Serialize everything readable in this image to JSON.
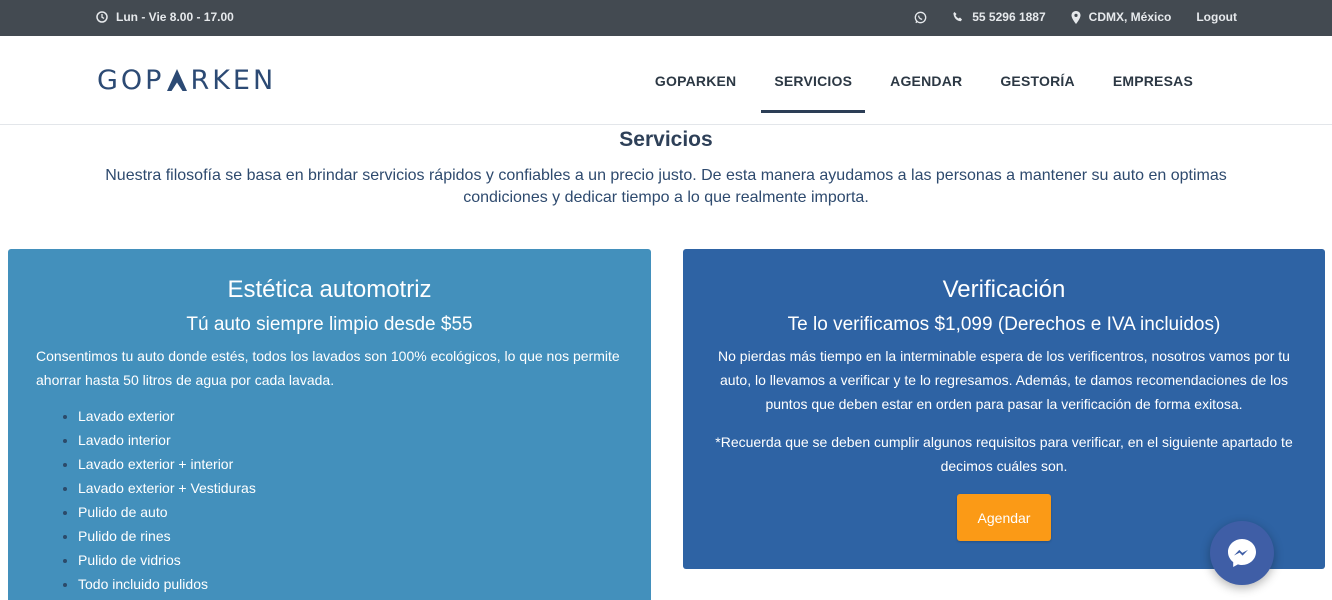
{
  "topbar": {
    "hours": "Lun - Vie 8.00 - 17.00",
    "phone": "55 5296 1887",
    "location": "CDMX, México",
    "logout": "Logout"
  },
  "header": {
    "logo_text_left": "GOP",
    "logo_text_right": "RKEN",
    "nav": [
      {
        "label": "GOPARKEN",
        "active": false
      },
      {
        "label": "SERVICIOS",
        "active": true
      },
      {
        "label": "AGENDAR",
        "active": false
      },
      {
        "label": "GESTORÍA",
        "active": false
      },
      {
        "label": "EMPRESAS",
        "active": false
      }
    ]
  },
  "intro": {
    "title": "Servicios",
    "text": "Nuestra filosofía se basa en brindar servicios rápidos y confiables a un precio justo. De esta manera ayudamos a las personas a mantener su auto en optimas condiciones y dedicar tiempo a lo que realmente importa."
  },
  "cards": {
    "estetica": {
      "title": "Estética automotriz",
      "subtitle": "Tú auto siempre limpio desde $55",
      "description": "Consentimos tu auto donde estés, todos los lavados son 100% ecológicos, lo que nos permite ahorrar hasta 50 litros de agua por cada lavada.",
      "items": [
        "Lavado exterior",
        "Lavado interior",
        "Lavado exterior + interior",
        "Lavado exterior + Vestiduras",
        "Pulido de auto",
        "Pulido de rines",
        "Pulido de vidrios",
        "Todo incluido pulidos"
      ]
    },
    "verificacion": {
      "title": "Verificación",
      "subtitle": "Te lo verificamos $1,099 (Derechos e IVA incluidos)",
      "description": "No pierdas más tiempo en la interminable espera de los verificentros, nosotros vamos por tu auto, lo llevamos a verificar y te lo regresamos. Además, te damos recomendaciones de los puntos que deben estar en orden para pasar la verificación de forma exitosa.",
      "note": "*Recuerda que se deben cumplir algunos requisitos para verificar, en el siguiente apartado te decimos cuáles son.",
      "button": "Agendar"
    }
  },
  "colors": {
    "topbar": "#434a51",
    "card_left": "#4390bc",
    "card_right": "#2e63a4",
    "cta": "#fb9a16",
    "messenger": "#3f5ea6"
  },
  "icons": [
    "clock-icon",
    "whatsapp-icon",
    "phone-icon",
    "map-pin-icon",
    "messenger-icon"
  ]
}
